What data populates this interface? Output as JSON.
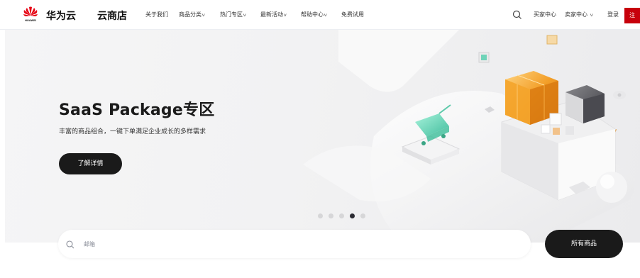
{
  "header": {
    "logo_text": "HUAWEI",
    "brand": "华为云",
    "store": "云商店",
    "nav": [
      {
        "label": "关于我们",
        "dropdown": false
      },
      {
        "label": "商品分类",
        "dropdown": true
      },
      {
        "label": "热门专区",
        "dropdown": true
      },
      {
        "label": "最新活动",
        "dropdown": true
      },
      {
        "label": "帮助中心",
        "dropdown": true
      },
      {
        "label": "免费试用",
        "dropdown": false
      }
    ],
    "buyer_center": "买家中心",
    "seller_center": "卖家中心",
    "login": "登录",
    "register": "注",
    "search_icon": "search-icon",
    "colors": {
      "register_bg": "#c7000b",
      "logo_red": "#e60012"
    }
  },
  "banner": {
    "title": "SaaS Package专区",
    "subtitle": "丰富的商品组合，一键下单满足企业成长的多样需求",
    "cta": "了解详情",
    "slides_total": 5,
    "slide_active": 4
  },
  "search": {
    "placeholder": "邮箱",
    "all_products": "所有商品"
  }
}
